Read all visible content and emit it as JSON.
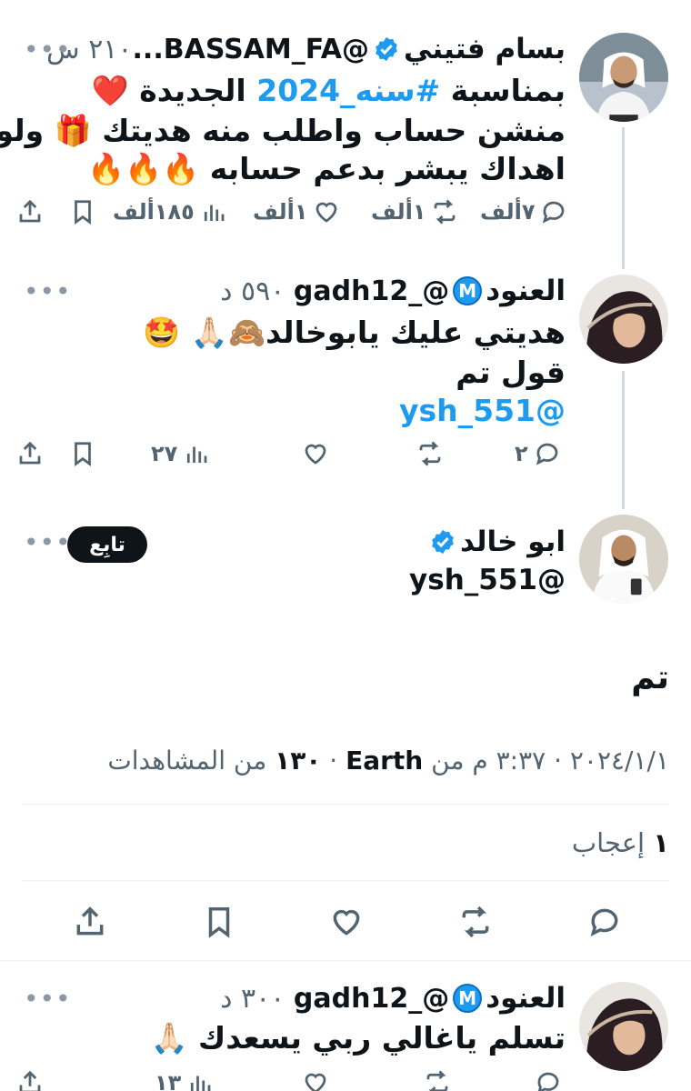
{
  "thread": [
    {
      "name": "بسام فتيني",
      "handle": "@BASSAM_FA...",
      "time": "٢١٠ س",
      "lines": [
        {
          "pre": "بمناسبة ",
          "hashtag": "#سنه_2024",
          "post": " الجديدة ❤️"
        },
        {
          "text": "منشن حساب واطلب منه هديتك 🎁 ولو"
        },
        {
          "text": "اهداك يبشر بدعم حسابه 🔥🔥🔥"
        }
      ],
      "stats": {
        "reply": "٧أ‌لف",
        "retweet": "١أ‌لف",
        "like": "١أ‌لف",
        "views": "١٨٥أ‌لف"
      }
    },
    {
      "name": "العنود",
      "badge": "M",
      "handle": "@_gadh12",
      "time": "٥٩٠ د",
      "lines": [
        {
          "text": "هديتي عليك يابوخالد🙈🙏🏻 🤩"
        },
        {
          "text": "قول تم"
        },
        {
          "mention": "@ysh_551"
        }
      ],
      "stats": {
        "reply": "٢",
        "retweet": "",
        "like": "",
        "views": "٢٧"
      }
    }
  ],
  "main": {
    "name": "ابو خالد",
    "handle": "@ysh_551",
    "follow_label": "تابِع",
    "text": "تم",
    "date": "٢٠٢٤/١/١",
    "time": "٣:٣٧ م",
    "source_prefix": "من",
    "source": "Earth",
    "views_count": "١٣٠",
    "views_label": "من المشاهدات",
    "likes_count": "١",
    "likes_label": "إعجاب"
  },
  "reply": {
    "name": "العنود",
    "badge": "M",
    "handle": "@_gadh12",
    "time": "٣٠٠ د",
    "text": "تسلم ياغالي ربي يسعدك 🙏🏻",
    "views": "١٣"
  },
  "icons": [
    "reply-icon",
    "retweet-icon",
    "like-icon",
    "views-icon",
    "bookmark-icon",
    "share-icon",
    "more-icon",
    "verified-icon"
  ],
  "colors": {
    "accent": "#1d9bf0",
    "text": "#0f1419",
    "muted": "#536471",
    "line": "#cfd9de"
  }
}
